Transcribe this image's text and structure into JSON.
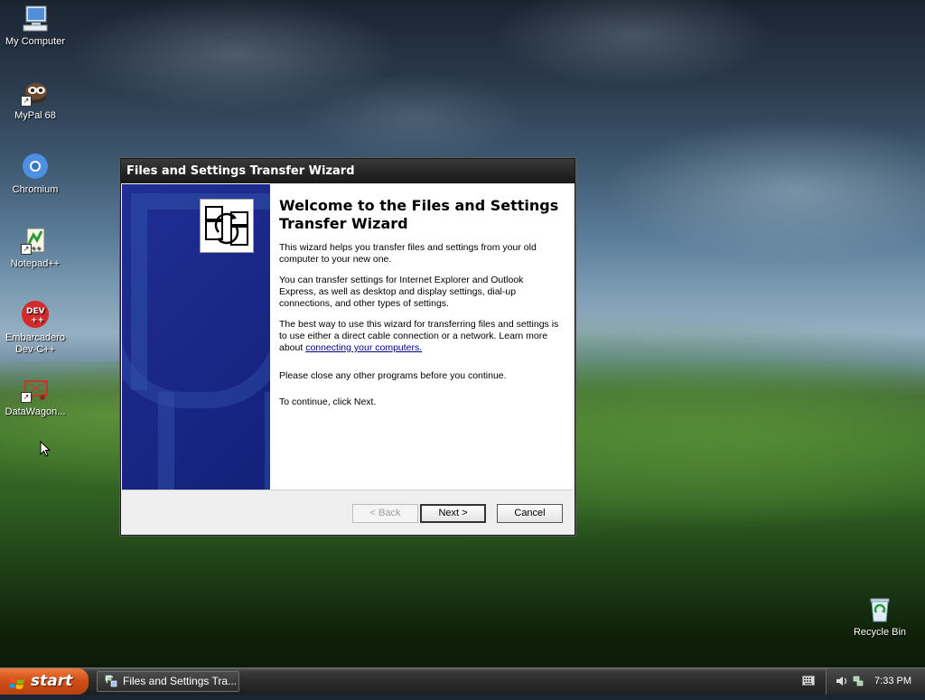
{
  "desktop": {
    "icons": [
      {
        "label": "My Computer",
        "icon": "computer-icon",
        "shortcut": false
      },
      {
        "label": "MyPal 68",
        "icon": "mypal-icon",
        "shortcut": true
      },
      {
        "label": "Chromium",
        "icon": "chromium-icon",
        "shortcut": false
      },
      {
        "label": "Notepad++",
        "icon": "notepad-plus-plus-icon",
        "shortcut": true
      },
      {
        "label": "Embarcadero Dev-C++",
        "icon": "devcpp-icon",
        "shortcut": false
      },
      {
        "label": "DataWagon...",
        "icon": "datawagon-icon",
        "shortcut": true
      }
    ],
    "recycle_bin": {
      "label": "Recycle Bin",
      "icon": "recycle-bin-icon"
    }
  },
  "wizard": {
    "title": "Files and Settings Transfer Wizard",
    "heading": "Welcome to the Files and Settings Transfer Wizard",
    "paragraph1": "This wizard helps you transfer files and settings from your old computer to your new one.",
    "paragraph2": "You can transfer settings for Internet Explorer and Outlook Express, as well as desktop and display settings, dial-up connections, and other types of settings.",
    "paragraph3_prefix": "The best way to use this wizard for transferring files and settings is to use either a direct cable connection or a network. Learn more about ",
    "paragraph3_link": "connecting your computers.",
    "paragraph4": "Please close any other programs before you continue.",
    "paragraph5": "To continue, click Next.",
    "buttons": {
      "back": "< Back",
      "next": "Next >",
      "cancel": "Cancel"
    },
    "logo_icon": "transfer-wizard-icon"
  },
  "taskbar": {
    "start_label": "start",
    "task_button_label": "Files and Settings Tra...",
    "clock": "7:33 PM"
  },
  "colors": {
    "wizard_sidebar": "#1a2787",
    "start_button": "#d0501a",
    "taskbar": "#2b2b2b",
    "link": "#000088"
  }
}
